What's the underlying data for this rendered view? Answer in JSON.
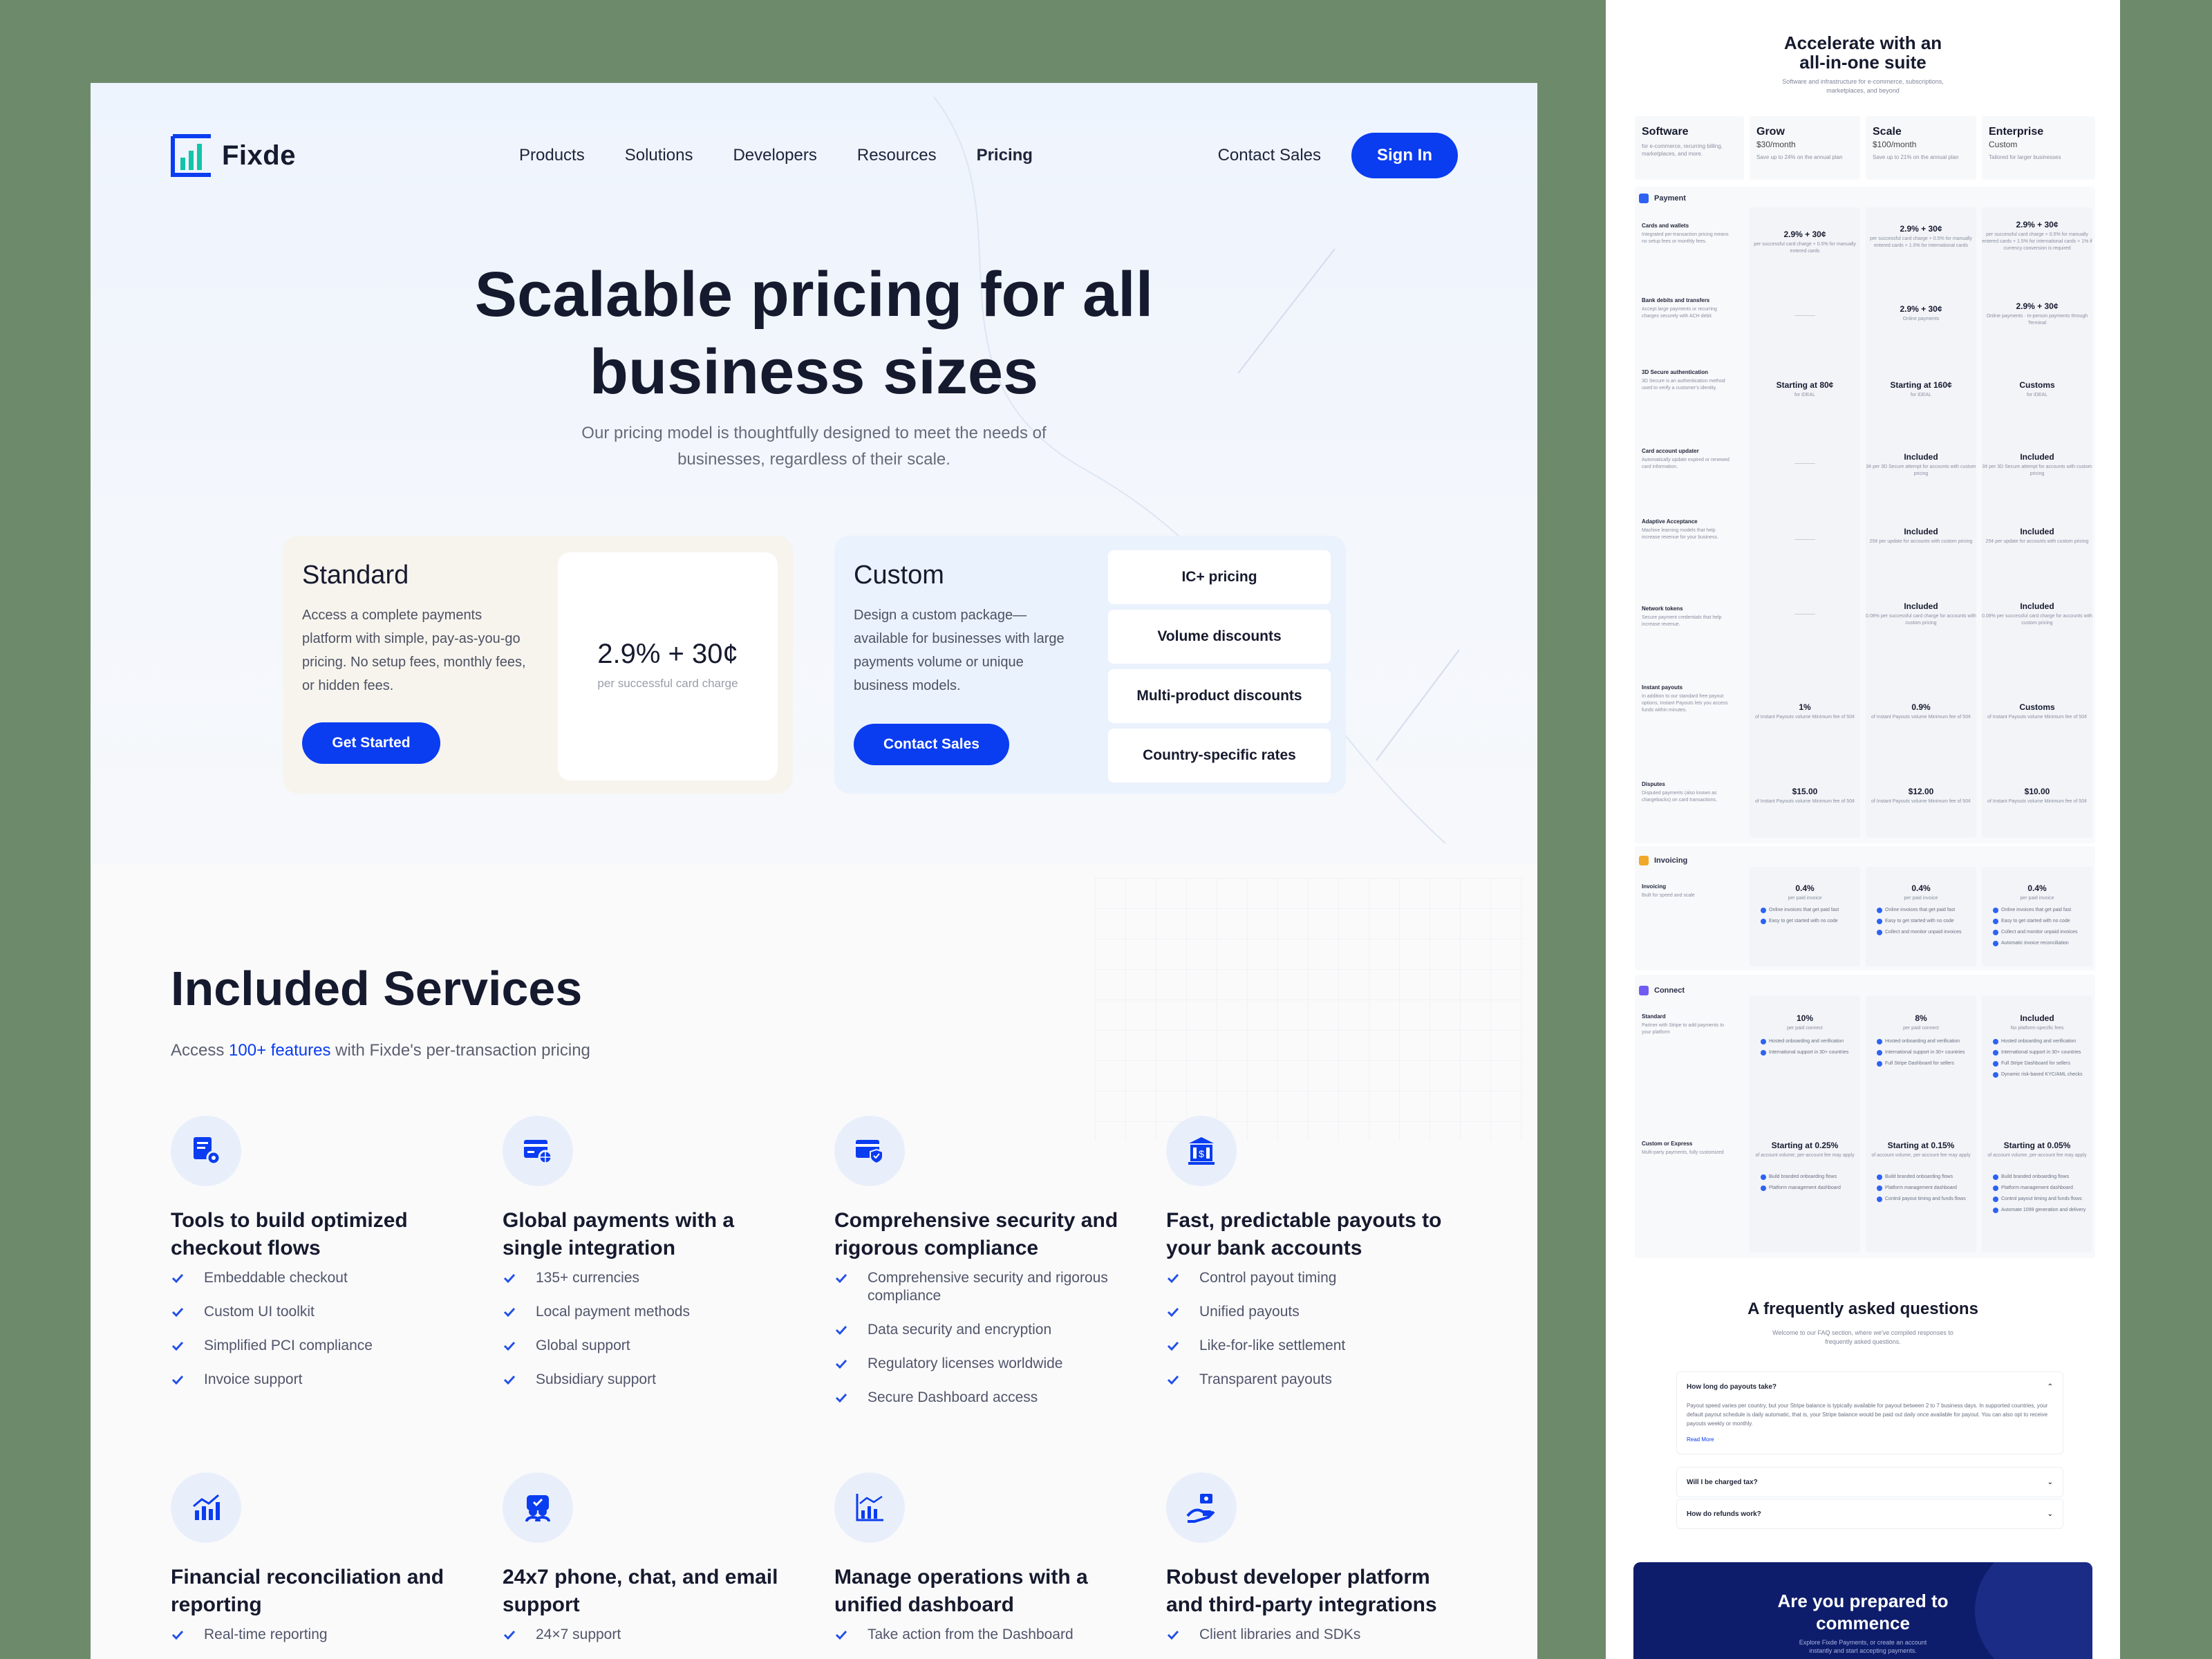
{
  "nav": {
    "brand": "Fixde",
    "items": [
      {
        "label": "Products"
      },
      {
        "label": "Solutions"
      },
      {
        "label": "Developers"
      },
      {
        "label": "Resources"
      },
      {
        "label": "Pricing"
      }
    ],
    "contact": "Contact Sales",
    "signin": "Sign In"
  },
  "hero": {
    "title_line1": "Scalable pricing for all",
    "title_line2": "business sizes",
    "sub_line1": "Our pricing model is thoughtfully designed to meet the needs of",
    "sub_line2": "businesses, regardless of their scale."
  },
  "standard": {
    "title": "Standard",
    "desc": "Access a complete payments platform with simple, pay-as-you-go pricing. No setup fees, monthly fees, or hidden fees.",
    "price": "2.9% + 30¢",
    "price_note": "per successful card charge",
    "button": "Get Started"
  },
  "custom": {
    "title": "Custom",
    "desc": "Design a custom package—available for businesses with large payments volume or unique business models.",
    "button": "Contact Sales",
    "options": [
      "IC+ pricing",
      "Volume discounts",
      "Multi-product discounts",
      "Country-specific rates"
    ]
  },
  "services": {
    "title": "Included Services",
    "lead_pre": "Access ",
    "lead_hl": "100+ features",
    "lead_post": " with Fixde's per-transaction pricing",
    "items": [
      {
        "title": "Tools to build optimized checkout flows",
        "features": [
          "Embeddable checkout",
          "Custom UI toolkit",
          "Simplified PCI compliance",
          "Invoice support"
        ]
      },
      {
        "title": "Global payments with a single integration",
        "features": [
          "135+ currencies",
          "Local payment methods",
          "Global support",
          "Subsidiary support"
        ]
      },
      {
        "title": "Comprehensive security and rigorous compliance",
        "features": [
          "Comprehensive security and rigorous compliance",
          "Data security and encryption",
          "Regulatory licenses worldwide",
          "Secure Dashboard access"
        ]
      },
      {
        "title": "Fast, predictable payouts to your bank accounts",
        "features": [
          "Control payout timing",
          "Unified payouts",
          "Like-for-like settlement",
          "Transparent payouts"
        ]
      },
      {
        "title": "Financial reconciliation and reporting",
        "features": [
          "Real-time reporting"
        ]
      },
      {
        "title": "24x7 phone, chat, and email support",
        "features": [
          "24×7 support"
        ]
      },
      {
        "title": "Manage operations with a unified dashboard",
        "features": [
          "Take action from the Dashboard"
        ]
      },
      {
        "title": "Robust developer platform and third-party integrations",
        "features": [
          "Client libraries and SDKs"
        ]
      }
    ]
  },
  "side": {
    "title_line1": "Accelerate with an",
    "title_line2": "all-in-one suite",
    "subtitle": "Software and infrastructure for e-commerce, subscriptions, marketplaces, and beyond",
    "plans": [
      {
        "name": "Software",
        "price": "",
        "note": "for e-commerce, recurring billing, marketplaces, and more."
      },
      {
        "name": "Grow",
        "price": "$30/month",
        "note": "Save up to 24% on the annual plan"
      },
      {
        "name": "Scale",
        "price": "$100/month",
        "note": "Save up to 21% on the annual plan"
      },
      {
        "name": "Enterprise",
        "price": "Custom",
        "note": "Tailored for larger businesses"
      }
    ],
    "payment": {
      "title": "Payment",
      "rows": [
        {
          "label": "Cards and wallets",
          "desc": "Integrated per-transaction pricing means no setup fees or monthly fees.",
          "cells": [
            [
              "2.9% + 30¢",
              "per successful card charge + 0.5% for manually entered cards"
            ],
            [
              "2.9% + 30¢",
              "per successful card charge + 0.5% for manually entered cards + 1.5% for international cards"
            ],
            [
              "2.9% + 30¢",
              "per successful card charge + 0.5% for manually entered cards + 1.5% for international cards + 1% if currency conversion is required"
            ]
          ]
        },
        {
          "label": "Bank debits and transfers",
          "desc": "Accept large payments or recurring charges securely with ACH debit.",
          "cells": [
            null,
            [
              "2.9% + 30¢",
              "Online payments"
            ],
            [
              "2.9% + 30¢",
              "Online payments · In-person payments through Terminal"
            ]
          ]
        },
        {
          "label": "3D Secure authentication",
          "desc": "3D Secure is an authentication method used to verify a customer's identity.",
          "cells": [
            [
              "Starting at 80¢",
              "for iDEAL"
            ],
            [
              "Starting at 160¢",
              "for iDEAL"
            ],
            [
              "Customs",
              "for iDEAL"
            ]
          ]
        },
        {
          "label": "Card account updater",
          "desc": "Automatically update expired or renewed card information.",
          "cells": [
            null,
            [
              "Included",
              "3¢ per 3D Secure attempt for accounts with custom pricing"
            ],
            [
              "Included",
              "3¢ per 3D Secure attempt for accounts with custom pricing"
            ]
          ]
        },
        {
          "label": "Adaptive Acceptance",
          "desc": "Machine learning models that help increase revenue for your business.",
          "cells": [
            null,
            [
              "Included",
              "25¢ per update for accounts with custom pricing"
            ],
            [
              "Included",
              "25¢ per update for accounts with custom pricing"
            ]
          ]
        },
        {
          "label": "Network tokens",
          "desc": "Secure payment credentials that help increase revenue.",
          "cells": [
            null,
            [
              "Included",
              "0.08% per successful card charge for accounts with custom pricing"
            ],
            [
              "Included",
              "0.08% per successful card charge for accounts with custom pricing"
            ]
          ]
        },
        {
          "label": "Instant payouts",
          "desc": "In addition to our standard free payout options, Instant Payouts lets you access funds within minutes.",
          "cells": [
            [
              "1%",
              "of Instant Payouts volume Minimum fee of 50¢"
            ],
            [
              "0.9%",
              "of Instant Payouts volume Minimum fee of 50¢"
            ],
            [
              "Customs",
              "of Instant Payouts volume Minimum fee of 50¢"
            ]
          ]
        },
        {
          "label": "Disputes",
          "desc": "Disputed payments (also known as chargebacks) on card transactions.",
          "cells": [
            [
              "$15.00",
              "of Instant Payouts volume Minimum fee of 50¢"
            ],
            [
              "$12.00",
              "of Instant Payouts volume Minimum fee of 50¢"
            ],
            [
              "$10.00",
              "of Instant Payouts volume Minimum fee of 50¢"
            ]
          ]
        }
      ]
    },
    "invoicing": {
      "title": "Invoicing",
      "label": "Invoicing",
      "desc": "Built for speed and scale",
      "cells": [
        {
          "value": "0.4%",
          "note": "per paid invoice",
          "items": [
            "Online invoices that get paid fast",
            "Easy to get started with no code"
          ]
        },
        {
          "value": "0.4%",
          "note": "per paid invoice",
          "items": [
            "Online invoices that get paid fast",
            "Easy to get started with no code",
            "Collect and monitor unpaid invoices"
          ]
        },
        {
          "value": "0.4%",
          "note": "per paid invoice",
          "items": [
            "Online invoices that get paid fast",
            "Easy to get started with no code",
            "Collect and monitor unpaid invoices",
            "Automatic invoice reconciliation"
          ]
        }
      ]
    },
    "connect": {
      "title": "Connect",
      "rows": [
        {
          "label": "Standard",
          "desc": "Partner with Stripe to add payments to your platform",
          "cells": [
            {
              "value": "10%",
              "note": "per paid connect",
              "items": [
                "Hosted onboarding and verification",
                "International support in 30+ countries"
              ]
            },
            {
              "value": "8%",
              "note": "per paid connect",
              "items": [
                "Hosted onboarding and verification",
                "International support in 30+ countries",
                "Full Stripe Dashboard for sellers"
              ]
            },
            {
              "value": "Included",
              "note": "No platform-specific fees",
              "items": [
                "Hosted onboarding and verification",
                "International support in 30+ countries",
                "Full Stripe Dashboard for sellers",
                "Dynamic risk-based KYC/AML checks"
              ]
            }
          ]
        },
        {
          "label": "Custom or Express",
          "desc": "Multi-party payments, fully customized",
          "cells": [
            {
              "value": "Starting at 0.25%",
              "note": "of account volume, per-account fee may apply",
              "items": [
                "Build branded onboarding flows",
                "Platform management dashboard"
              ]
            },
            {
              "value": "Starting at 0.15%",
              "note": "of account volume, per-account fee may apply",
              "items": [
                "Build branded onboarding flows",
                "Platform management dashboard",
                "Control payout timing and funds flows"
              ]
            },
            {
              "value": "Starting at 0.05%",
              "note": "of account volume, per-account fee may apply",
              "items": [
                "Build branded onboarding flows",
                "Platform management dashboard",
                "Control payout timing and funds flows",
                "Automate 1099 generation and delivery"
              ]
            }
          ]
        }
      ]
    },
    "faq": {
      "title": "A frequently asked questions",
      "subtitle": "Welcome to our FAQ section, where we've compiled responses to frequently asked questions.",
      "items": [
        {
          "q": "How long do payouts take?",
          "a": "Payout speed varies per country, but your Stripe balance is typically available for payout between 2 to 7 business days. In supported countries, your default payout schedule is daily automatic, that is, your Stripe balance would be paid out daily once available for payout. You can also opt to receive payouts weekly or monthly.",
          "more": "Read More"
        },
        {
          "q": "Will I be charged tax?"
        },
        {
          "q": "How do refunds work?"
        }
      ]
    },
    "cta": {
      "title_line1": "Are you prepared to",
      "title_line2": "commence",
      "text": "Explore Fixde Payments, or create an account instantly and start accepting payments."
    }
  }
}
